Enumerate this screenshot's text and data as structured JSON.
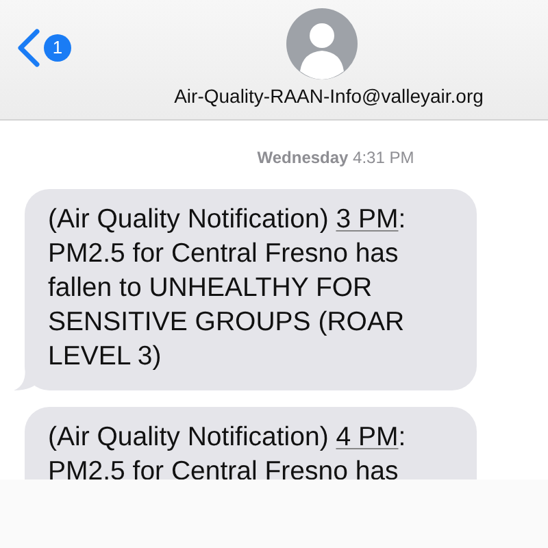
{
  "header": {
    "back_badge": "1",
    "contact": "Air-Quality-RAAN-Info@valleyair.org"
  },
  "timestamp": "**Wednesday** 4:31 PM",
  "messages": [
    {
      "before": "(Air Quality Notification) ",
      "link": "3 PM",
      "after": ": PM2.5 for Central Fresno has fallen to UNHEALTHY FOR SENSITIVE GROUPS (ROAR LEVEL 3)",
      "tail": true
    },
    {
      "before": "(Air Quality Notification) ",
      "link": "4 PM",
      "after": ": PM2.5 for Central Fresno has"
    }
  ]
}
